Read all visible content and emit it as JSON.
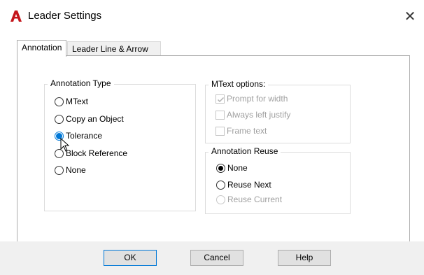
{
  "window": {
    "title": "Leader Settings",
    "close_glyph": "✕",
    "brand_color": "#c4161c"
  },
  "tabs": [
    {
      "label": "Annotation",
      "active": true
    },
    {
      "label": "Leader Line & Arrow",
      "active": false
    }
  ],
  "annotation_type": {
    "title": "Annotation Type",
    "options": [
      {
        "label": "MText",
        "checked": false
      },
      {
        "label": "Copy an Object",
        "checked": false
      },
      {
        "label": "Tolerance",
        "checked": true
      },
      {
        "label": "Block Reference",
        "checked": false
      },
      {
        "label": "None",
        "checked": false
      }
    ]
  },
  "mtext_options": {
    "title": "MText options:",
    "options": [
      {
        "label": "Prompt for width",
        "checked": true,
        "enabled": false
      },
      {
        "label": "Always left justify",
        "checked": false,
        "enabled": false
      },
      {
        "label": "Frame text",
        "checked": false,
        "enabled": false
      }
    ]
  },
  "annotation_reuse": {
    "title": "Annotation Reuse",
    "options": [
      {
        "label": "None",
        "checked": true,
        "enabled": true
      },
      {
        "label": "Reuse Next",
        "checked": false,
        "enabled": true
      },
      {
        "label": "Reuse Current",
        "checked": false,
        "enabled": false
      }
    ]
  },
  "buttons": {
    "ok": "OK",
    "cancel": "Cancel",
    "help": "Help"
  }
}
